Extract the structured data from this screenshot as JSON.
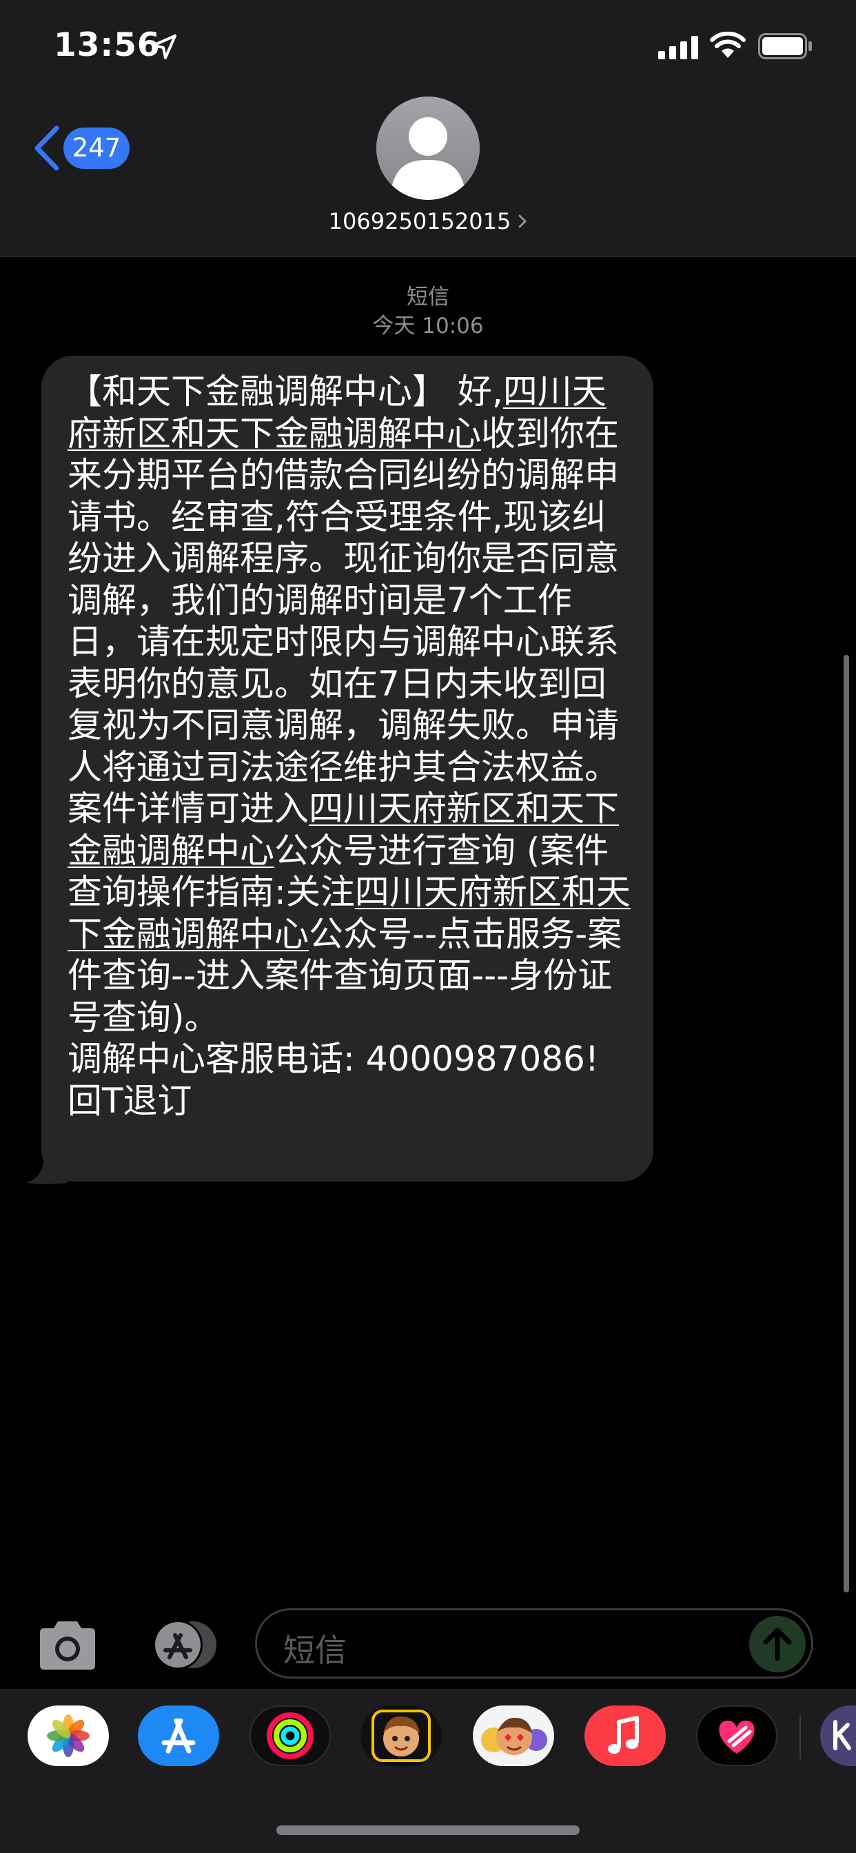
{
  "status_bar": {
    "time": "13:56"
  },
  "header": {
    "back_count": "247",
    "contact": "1069250152015"
  },
  "message": {
    "type_label": "短信",
    "timestamp": "今天 10:06",
    "body": [
      "【和天下金融调解中心】 ",
      "好,",
      "四川天府新区和天下金融调解中心",
      "收到你在来分期平台的借款合同纠纷的调解申请书。经审查,符合受理条件,现该纠纷进入调解程序。现征询你是否同意调解，我们的调解时间是7个工作日，请在规定时限内与调解中心联系表明你的意见。如在7日内未收到回复视为不同意调解，调解失败。申请人将通过司法途径维护其合法权益。案件详情可进入",
      "四川天府新区和天下金融调解中心",
      "公众号进行查询 (案件查询操作指南:关注",
      "四川天府新区和天下金融调解中心",
      "公众号--点击服务-案件查询--进入案件查询页面---身份证号查询)。\n调解中心客服电话: 4000987086!\n回T退订"
    ]
  },
  "input": {
    "placeholder": "短信"
  },
  "colors": {
    "accent": "#3478f6",
    "bubble": "#262628",
    "bar": "#1c1c1e",
    "music": "#fc3c44"
  },
  "app_drawer": [
    "photos-icon",
    "app-store-icon",
    "activity-icon",
    "memoji-icon",
    "memoji-stickers-icon",
    "music-icon",
    "digital-touch-icon"
  ]
}
